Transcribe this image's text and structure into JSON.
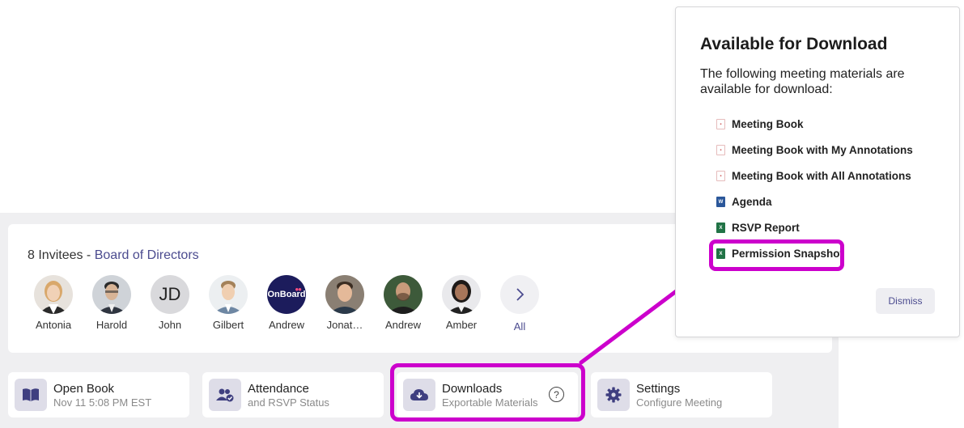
{
  "invitees": {
    "count_label": "8 Invitees -",
    "group_name": "Board of Directors",
    "people": [
      {
        "name": "Antonia"
      },
      {
        "name": "Harold"
      },
      {
        "name": "John",
        "initials": "JD"
      },
      {
        "name": "Gilbert"
      },
      {
        "name": "Andrew",
        "logo_text": "OnBoard"
      },
      {
        "name": "Jonat…"
      },
      {
        "name": "Andrew"
      },
      {
        "name": "Amber"
      }
    ],
    "all_label": "All"
  },
  "tiles": {
    "open_book": {
      "title": "Open Book",
      "subtitle": "Nov 11 5:08 PM EST",
      "icon": "book-icon"
    },
    "attendance": {
      "title": "Attendance",
      "subtitle": "and RSVP Status",
      "icon": "people-check-icon"
    },
    "downloads": {
      "title": "Downloads",
      "subtitle": "Exportable Materials",
      "icon": "cloud-download-icon",
      "help": "?"
    },
    "settings": {
      "title": "Settings",
      "subtitle": "Configure Meeting",
      "icon": "gear-icon"
    }
  },
  "popover": {
    "title": "Available for Download",
    "description": "The following meeting materials are available for download:",
    "items": [
      {
        "label": "Meeting Book",
        "file_type": "pdf"
      },
      {
        "label": "Meeting Book with My Annotations",
        "file_type": "pdf"
      },
      {
        "label": "Meeting Book with All Annotations",
        "file_type": "pdf"
      },
      {
        "label": "Agenda",
        "file_type": "word"
      },
      {
        "label": "RSVP Report",
        "file_type": "excel"
      },
      {
        "label": "Permission Snapshot",
        "file_type": "excel"
      }
    ],
    "dismiss_label": "Dismiss"
  },
  "colors": {
    "accent": "#4b4b8f",
    "highlight": "#cc00cc",
    "icon_tile_bg": "#dedde8"
  }
}
